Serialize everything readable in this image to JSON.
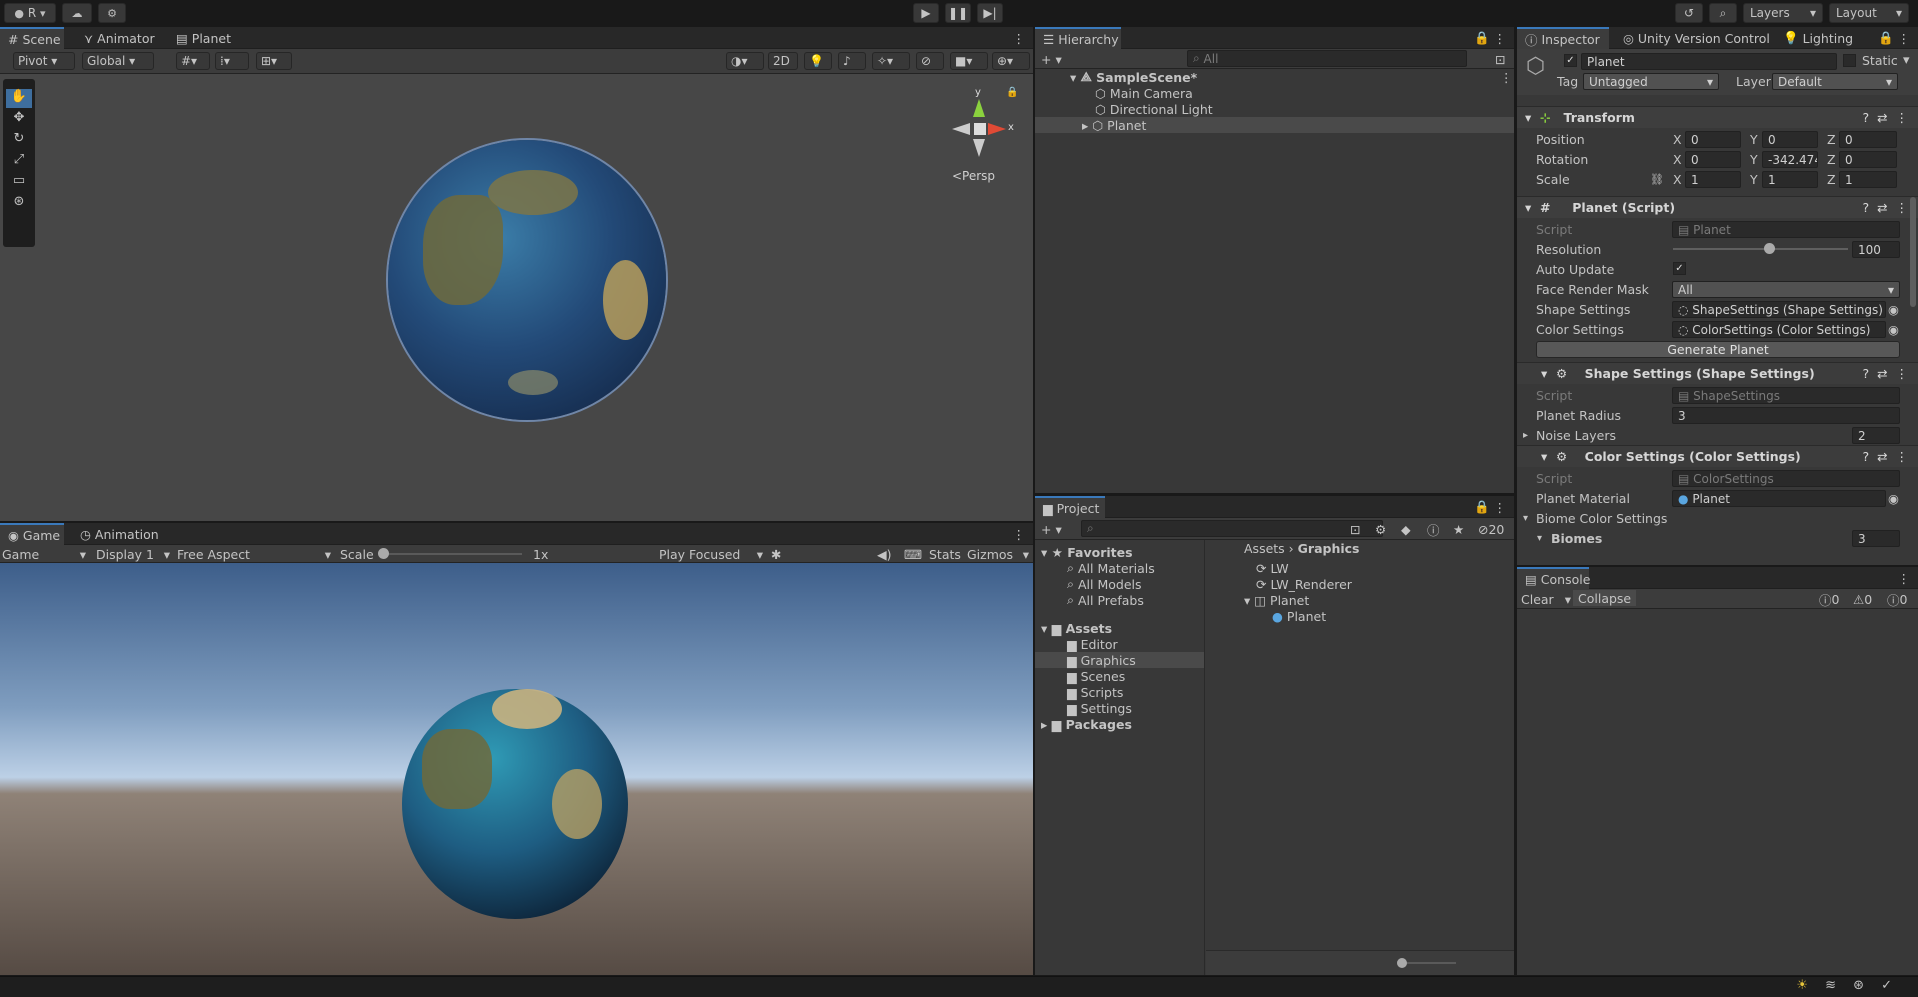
{
  "toolbar": {
    "account": "R",
    "layers": "Layers",
    "layout": "Layout"
  },
  "scene_panel": {
    "tabs": [
      "Scene",
      "Animator",
      "Planet"
    ],
    "pivot": "Pivot",
    "global": "Global",
    "mode_2d": "2D",
    "persp": "<Persp",
    "axis_y": "y",
    "axis_x": "x"
  },
  "game_panel": {
    "tabs": [
      "Game",
      "Animation"
    ],
    "game": "Game",
    "display": "Display 1",
    "aspect": "Free Aspect",
    "scale_label": "Scale",
    "scale_value": "1x",
    "play_focused": "Play Focused",
    "stats": "Stats",
    "gizmos": "Gizmos"
  },
  "hierarchy": {
    "tab": "Hierarchy",
    "search_placeholder": "All",
    "scene": "SampleScene*",
    "items": [
      "Main Camera",
      "Directional Light",
      "Planet"
    ]
  },
  "project": {
    "tab": "Project",
    "favorites": "Favorites",
    "fav_items": [
      "All Materials",
      "All Models",
      "All Prefabs"
    ],
    "assets": "Assets",
    "asset_folders": [
      "Editor",
      "Graphics",
      "Scenes",
      "Scripts",
      "Settings"
    ],
    "packages": "Packages",
    "breadcrumb": [
      "Assets",
      "Graphics"
    ],
    "files": [
      "LW",
      "LW_Renderer",
      "Planet",
      "Planet"
    ],
    "hidden_count": "20"
  },
  "inspector": {
    "tabs": [
      "Inspector",
      "Unity Version Control",
      "Lighting"
    ],
    "object_name": "Planet",
    "static": "Static",
    "tag_label": "Tag",
    "tag_value": "Untagged",
    "layer_label": "Layer",
    "layer_value": "Default",
    "transform": {
      "title": "Transform",
      "position_label": "Position",
      "rotation_label": "Rotation",
      "scale_label": "Scale",
      "position": [
        "0",
        "0",
        "0"
      ],
      "rotation": [
        "0",
        "-342.474",
        "0"
      ],
      "scale": [
        "1",
        "1",
        "1"
      ],
      "axis": [
        "X",
        "Y",
        "Z"
      ]
    },
    "planet_script": {
      "title": "Planet (Script)",
      "script_label": "Script",
      "script_value": "Planet",
      "resolution_label": "Resolution",
      "resolution_value": "100",
      "resolution_fraction": 0.55,
      "auto_update_label": "Auto Update",
      "face_mask_label": "Face Render Mask",
      "face_mask_value": "All",
      "shape_label": "Shape Settings",
      "shape_value": "ShapeSettings (Shape Settings)",
      "color_label": "Color Settings",
      "color_value": "ColorSettings (Color Settings)",
      "generate": "Generate Planet"
    },
    "shape_settings": {
      "title": "Shape Settings (Shape Settings)",
      "script_label": "Script",
      "script_value": "ShapeSettings",
      "radius_label": "Planet Radius",
      "radius_value": "3",
      "noise_label": "Noise Layers",
      "noise_value": "2"
    },
    "color_settings": {
      "title": "Color Settings (Color Settings)",
      "script_label": "Script",
      "script_value": "ColorSettings",
      "material_label": "Planet Material",
      "material_value": "Planet",
      "biome_label": "Biome Color Settings",
      "biomes_label": "Biomes",
      "biomes_value": "3"
    }
  },
  "console": {
    "tab": "Console",
    "clear": "Clear",
    "collapse": "Collapse",
    "info_count": "0",
    "warn_count": "0",
    "error_count": "0"
  },
  "colors": {
    "accent": "#3a79bb",
    "panel": "#383838",
    "dark": "#191919"
  }
}
